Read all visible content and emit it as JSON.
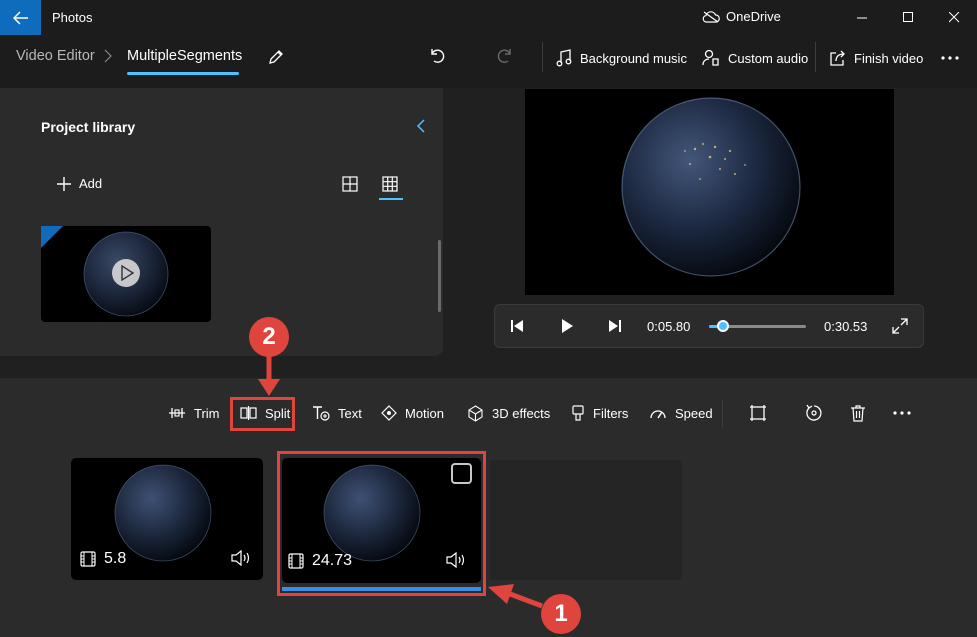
{
  "app": {
    "title": "Photos",
    "cloud_label": "OneDrive"
  },
  "breadcrumb": {
    "parent": "Video Editor",
    "current": "MultipleSegments"
  },
  "toolbar": {
    "background_music": "Background music",
    "custom_audio": "Custom audio",
    "finish_video": "Finish video"
  },
  "library": {
    "title": "Project library",
    "add_label": "Add"
  },
  "player": {
    "current_time": "0:05.80",
    "total_time": "0:30.53",
    "progress": 0.19
  },
  "storyboard": {
    "tools": {
      "trim": "Trim",
      "split": "Split",
      "text": "Text",
      "motion": "Motion",
      "effects_3d": "3D effects",
      "filters": "Filters",
      "speed": "Speed"
    },
    "clips": [
      {
        "duration": "5.8",
        "selected": false
      },
      {
        "duration": "24.73",
        "selected": true
      }
    ]
  },
  "annotations": {
    "step1": "1",
    "step2": "2"
  },
  "colors": {
    "accent": "#4cc2ff",
    "title_accent": "#0f6cbd",
    "annotation": "#e0453d"
  },
  "icons": [
    "back-arrow-icon",
    "cloud-off-icon",
    "minimize-icon",
    "maximize-icon",
    "close-icon",
    "pencil-icon",
    "undo-icon",
    "redo-icon",
    "music-note-icon",
    "custom-audio-icon",
    "share-icon",
    "more-icon",
    "chevron-left-icon",
    "plus-icon",
    "grid-small-icon",
    "grid-large-icon",
    "play-icon",
    "skip-back-icon",
    "skip-forward-icon",
    "fullscreen-icon",
    "trim-icon",
    "split-icon",
    "text-icon",
    "motion-icon",
    "3d-effects-icon",
    "filters-icon",
    "speed-icon",
    "crop-icon",
    "rotate-icon",
    "delete-icon",
    "film-icon",
    "volume-icon"
  ]
}
